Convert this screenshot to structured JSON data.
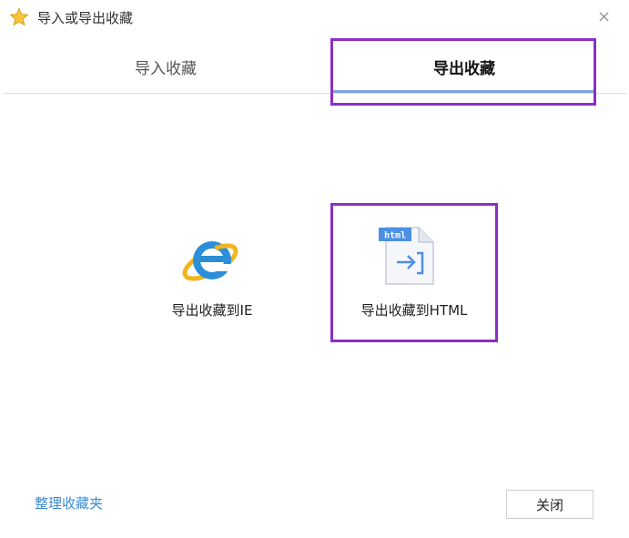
{
  "window": {
    "title": "导入或导出收藏",
    "close_glyph": "×"
  },
  "tabs": [
    {
      "label": "导入收藏",
      "active": false
    },
    {
      "label": "导出收藏",
      "active": true
    }
  ],
  "options": {
    "ie": {
      "label": "导出收藏到IE",
      "icon": "ie-icon"
    },
    "html": {
      "label": "导出收藏到HTML",
      "icon": "html-file-icon",
      "badge": "html"
    }
  },
  "footer": {
    "organize_link": "整理收藏夹",
    "close_button": "关闭"
  },
  "colors": {
    "accent": "#7aa6e0",
    "highlight": "#8a2fc6",
    "link": "#3d8bd1"
  }
}
